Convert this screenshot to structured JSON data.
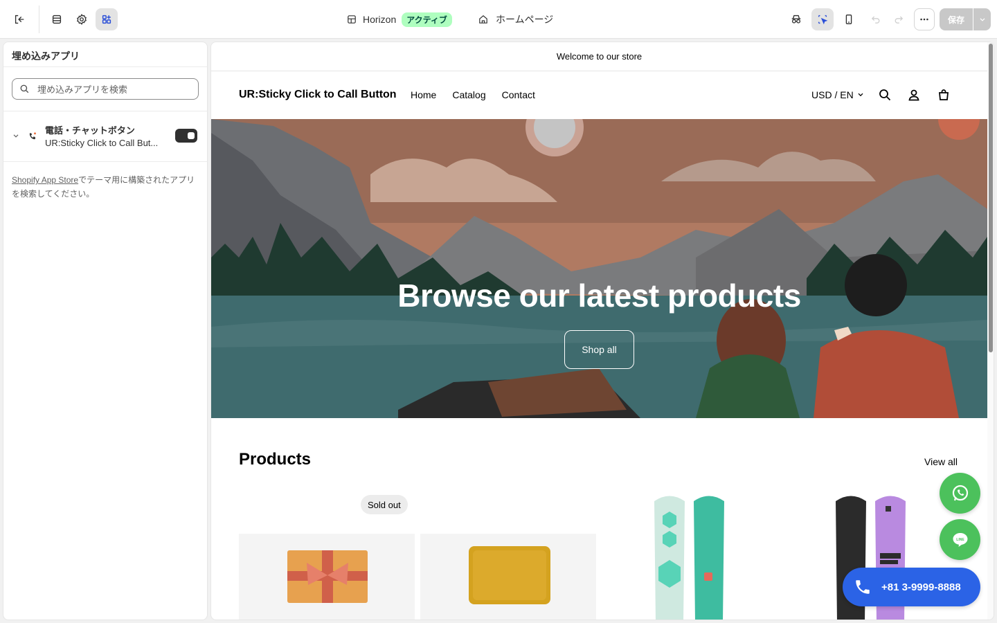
{
  "topbar": {
    "theme_name": "Horizon",
    "theme_status": "アクティブ",
    "page_name": "ホームページ",
    "save_label": "保存",
    "icons": [
      "exit-icon",
      "sections-icon",
      "settings-icon",
      "apps-icon",
      "theme-icon",
      "home-icon",
      "spy-icon",
      "inspector-icon",
      "mobile-icon",
      "undo-icon",
      "redo-icon",
      "more-icon",
      "chevron-down-icon"
    ]
  },
  "sidebar": {
    "title": "埋め込みアプリ",
    "search_placeholder": "埋め込みアプリを検索",
    "app": {
      "name": "電話・チャットボタン",
      "subtitle": "UR:Sticky Click to Call But...",
      "enabled": true
    },
    "note_link": "Shopify App Store",
    "note_text": "でテーマ用に構築されたアプリを検索してください。"
  },
  "preview": {
    "announcement": "Welcome to our store",
    "logo": "UR:Sticky Click to Call Button",
    "nav": [
      "Home",
      "Catalog",
      "Contact"
    ],
    "currency": "USD / EN",
    "hero_title": "Browse our latest products",
    "hero_button": "Shop all",
    "products_title": "Products",
    "view_all": "View all",
    "sold_out": "Sold out"
  },
  "widgets": {
    "phone_number": "+81 3-9999-8888",
    "line_label": "LINE",
    "colors": {
      "whatsapp": "#4cc15c",
      "line": "#4cc15c",
      "call": "#2b63e6"
    }
  },
  "colors": {
    "accent_badge_bg": "#affebf",
    "accent_badge_text": "#014b40"
  }
}
